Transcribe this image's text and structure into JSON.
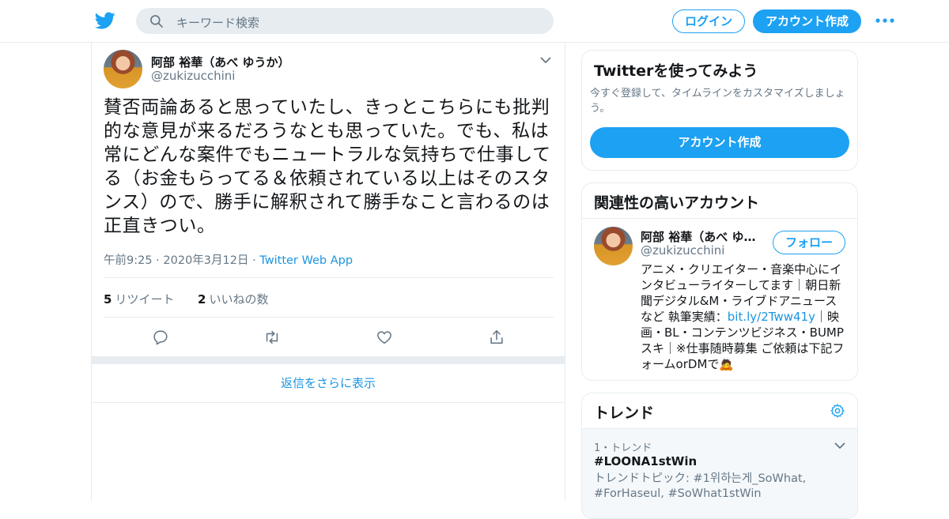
{
  "header": {
    "search_placeholder": "キーワード検索",
    "login_label": "ログイン",
    "signup_label": "アカウント作成"
  },
  "tweet": {
    "display_name": "阿部 裕華（あべ ゆうか）",
    "handle": "@zukizucchini",
    "text": "賛否両論あると思っていたし、きっとこちらにも批判的な意見が来るだろうなとも思っていた。でも、私は常にどんな案件でもニュートラルな気持ちで仕事してる（お金もらってる＆依頼されている以上はそのスタンス）ので、勝手に解釈されて勝手なこと言わるのは正直きつい。",
    "timestamp": "午前9:25 · 2020年3月12日",
    "meta_sep": " · ",
    "source": "Twitter Web App",
    "retweets_count": "5",
    "retweets_label": "リツイート",
    "likes_count": "2",
    "likes_label": "いいねの数",
    "show_more_replies": "返信をさらに表示"
  },
  "signup_card": {
    "title": "Twitterを使ってみよう",
    "description": "今すぐ登録して、タイムラインをカスタマイズしましょう。",
    "cta_label": "アカウント作成"
  },
  "related": {
    "title": "関連性の高いアカウント",
    "name": "阿部 裕華（あべ ゆうか）",
    "handle": "@zukizucchini",
    "follow_label": "フォロー",
    "bio_before": "アニメ・クリエイター・音楽中心にインタビューライターしてます｜朝日新聞デジタル&M・ライブドアニュースなど 執筆実績：",
    "bio_link": "bit.ly/2Tww41y",
    "bio_after": "｜映画・BL・コンテンツビジネス・BUMPスキ｜※仕事随時募集 ご依頼は下記フォームorDMで🙇"
  },
  "trends": {
    "title": "トレンド",
    "items": [
      {
        "rank_label": "1・トレンド",
        "tag": "#LOONA1stWin",
        "topics": "トレンドトピック: #1위하는게_SoWhat, #ForHaseul, #SoWhat1stWin"
      }
    ]
  },
  "colors": {
    "accent": "#1da1f2",
    "link": "#1b95e0",
    "muted": "#657786",
    "border": "#e6ecf0"
  }
}
